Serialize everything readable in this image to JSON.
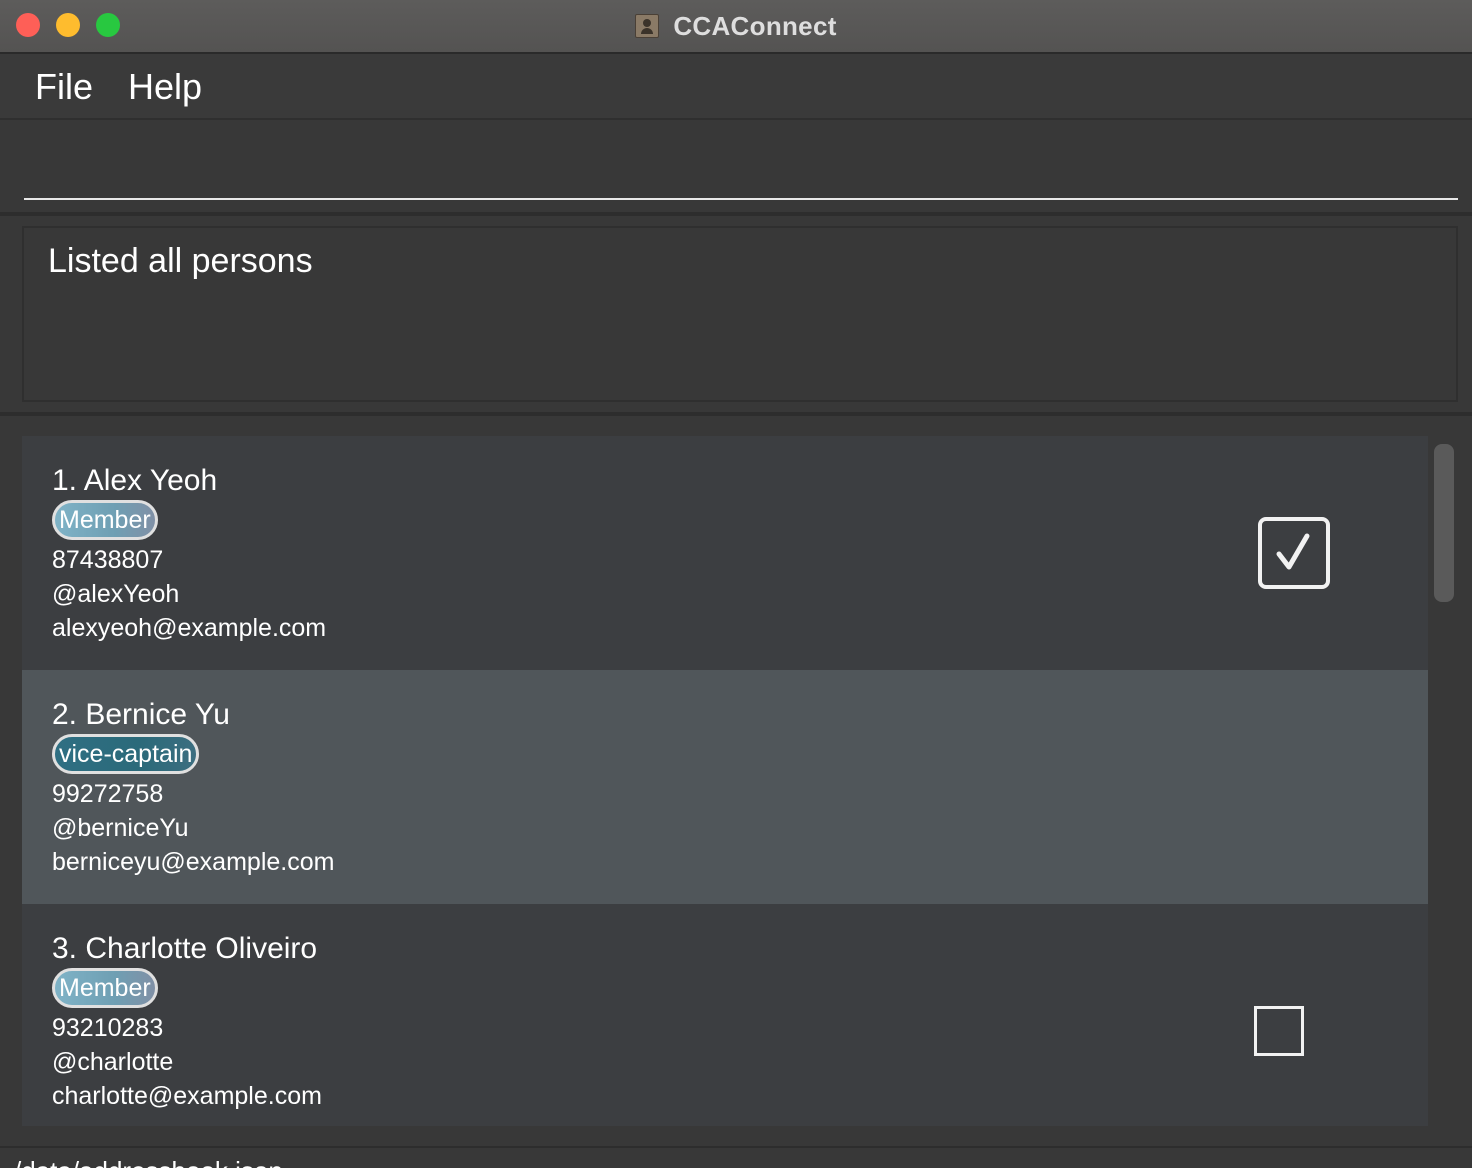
{
  "window": {
    "title": "CCAConnect"
  },
  "menu": {
    "file": "File",
    "help": "Help"
  },
  "command": {
    "value": "",
    "placeholder": ""
  },
  "result": {
    "message": "Listed all persons"
  },
  "persons": [
    {
      "name": "1. Alex Yeoh",
      "tag": "Member",
      "phone": "87438807",
      "handle": "@alexYeoh",
      "email": "alexyeoh@example.com",
      "attendance": "checked"
    },
    {
      "name": "2. Bernice Yu",
      "tag": "vice-captain",
      "phone": "99272758",
      "handle": "@berniceYu",
      "email": "berniceyu@example.com",
      "attendance": "none"
    },
    {
      "name": "3. Charlotte Oliveiro",
      "tag": "Member",
      "phone": "93210283",
      "handle": "@charlotte",
      "email": "charlotte@example.com",
      "attendance": "unchecked"
    }
  ],
  "status": {
    "path": "/data/addressbook.json"
  },
  "colors": {
    "tag_member": "#7fb3c7",
    "tag_vice_captain": "#2f6f83",
    "selected_row": "#50565a"
  }
}
